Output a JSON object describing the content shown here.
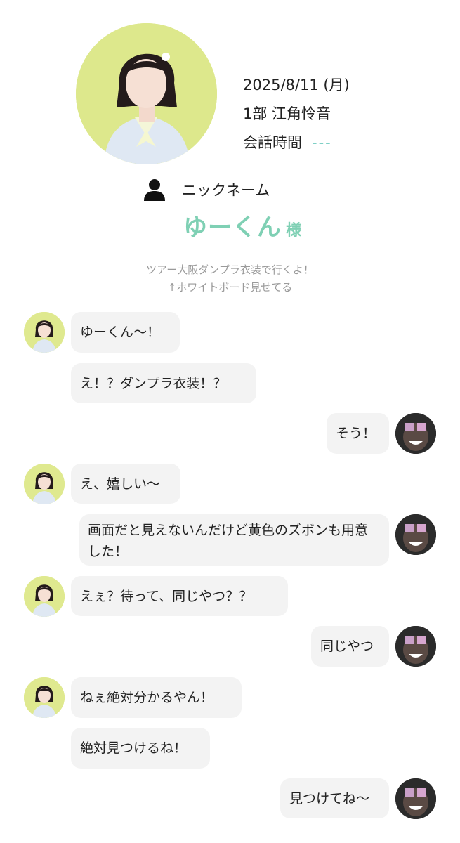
{
  "profile": {
    "date": "2025/8/11 (月)",
    "part_member": "1部  江角怜音",
    "talk_time_label": "会話時間",
    "talk_time_value": "---"
  },
  "nickname": {
    "label": "ニックネーム",
    "name": "ゆーくん",
    "honorific": "様",
    "icon": "person-icon"
  },
  "memo": {
    "line1": "ツアー大阪ダンプラ衣装で行くよ！",
    "line2": "↑ホワイトボード見せてる"
  },
  "colors": {
    "accent": "#7fd0b4",
    "bubble": "#f3f3f3",
    "memo_text": "#9a9a9a",
    "idol_avatar_bg": "#dfe98f",
    "fan_avatar_bg": "#2b2b2b"
  },
  "messages": [
    {
      "from": "idol",
      "text": "ゆーくん〜！"
    },
    {
      "from": "idol",
      "text": "え！？ダンプラ衣装！？"
    },
    {
      "from": "fan",
      "text": "そう！"
    },
    {
      "from": "idol",
      "text": "え、嬉しい〜"
    },
    {
      "from": "fan",
      "text": "画面だと見えないんだけど黄色のズボンも用意した！"
    },
    {
      "from": "idol",
      "text": "えぇ？待って、同じやつ？？"
    },
    {
      "from": "fan",
      "text": "同じやつ"
    },
    {
      "from": "idol",
      "text": "ねぇ絶対分かるやん！"
    },
    {
      "from": "idol",
      "text": "絶対見つけるね！"
    },
    {
      "from": "fan",
      "text": "見つけてね〜"
    }
  ]
}
